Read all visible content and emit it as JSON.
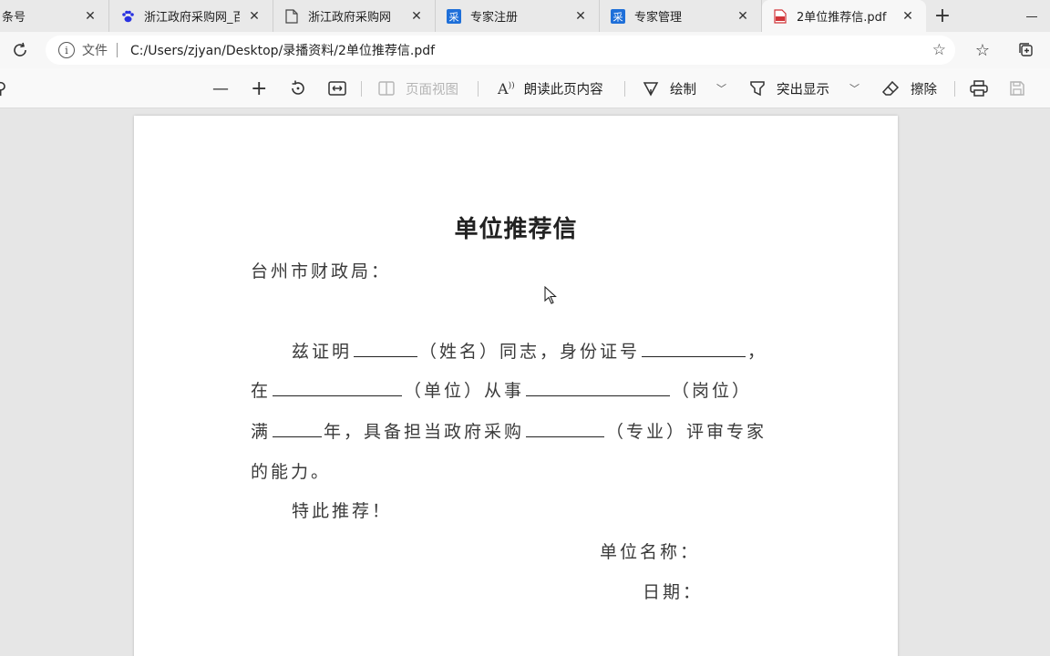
{
  "browser": {
    "tabs": [
      {
        "title": "条号",
        "favicon": "page-icon",
        "active": false
      },
      {
        "title": "浙江政府采购网_百",
        "favicon": "baidu-paw-icon",
        "active": false
      },
      {
        "title": "浙江政府采购网",
        "favicon": "page-icon",
        "active": false
      },
      {
        "title": "专家注册",
        "favicon": "site-icon",
        "active": false
      },
      {
        "title": "专家管理",
        "favicon": "site-icon",
        "active": false
      },
      {
        "title": "2单位推荐信.pdf",
        "favicon": "pdf-icon",
        "active": true
      }
    ],
    "address": {
      "scheme_label": "文件",
      "url": "C:/Users/zjyan/Desktop/录播资料/2单位推荐信.pdf"
    }
  },
  "pdf_toolbar": {
    "page_view_label": "页面视图",
    "read_aloud_label": "朗读此页内容",
    "draw_label": "绘制",
    "highlight_label": "突出显示",
    "erase_label": "擦除"
  },
  "document": {
    "title": "单位推荐信",
    "salutation": "台州市财政局：",
    "para1_a": "兹证明",
    "para1_b": "（姓名）同志，身份证号",
    "para1_c": "，",
    "para2_a": "在",
    "para2_b": "（单位）从事",
    "para2_c": "（岗位）",
    "para3_a": "满",
    "para3_b": "年，具备担当政府采购",
    "para3_c": "（专业）评审专家",
    "para4": "的能力。",
    "recommend": "特此推荐！",
    "unit_name_label": "单位名称：",
    "date_label": "日期："
  },
  "colors": {
    "tab_strip": "#e9e9e9",
    "active_tab": "#f7f7f7",
    "viewer_background": "#e6e6e6",
    "pdf_icon": "#d13438",
    "site_icon": "#1e6fd9",
    "baidu_icon": "#2932e1"
  }
}
